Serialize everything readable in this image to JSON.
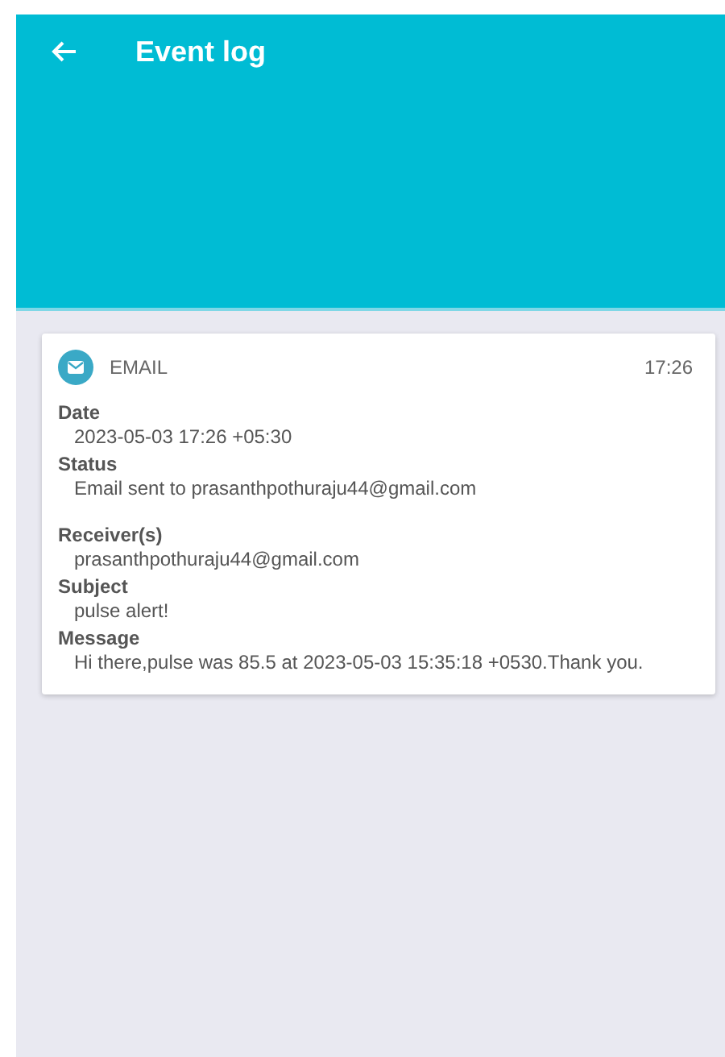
{
  "app_bar": {
    "title": "Event log"
  },
  "events": [
    {
      "kind": "email",
      "type_label": "EMAIL",
      "time": "17:26",
      "fields": [
        {
          "label": "Date",
          "value": "2023-05-03 17:26 +05:30"
        },
        {
          "label": "Status",
          "value": "Email sent to prasanthpothuraju44@gmail.com"
        },
        {
          "label": "Receiver(s)",
          "value": "prasanthpothuraju44@gmail.com"
        },
        {
          "label": "Subject",
          "value": "pulse alert!"
        },
        {
          "label": "Message",
          "value": "Hi there,pulse was 85.5 at 2023-05-03 15:35:18 +0530.Thank you."
        }
      ]
    }
  ]
}
